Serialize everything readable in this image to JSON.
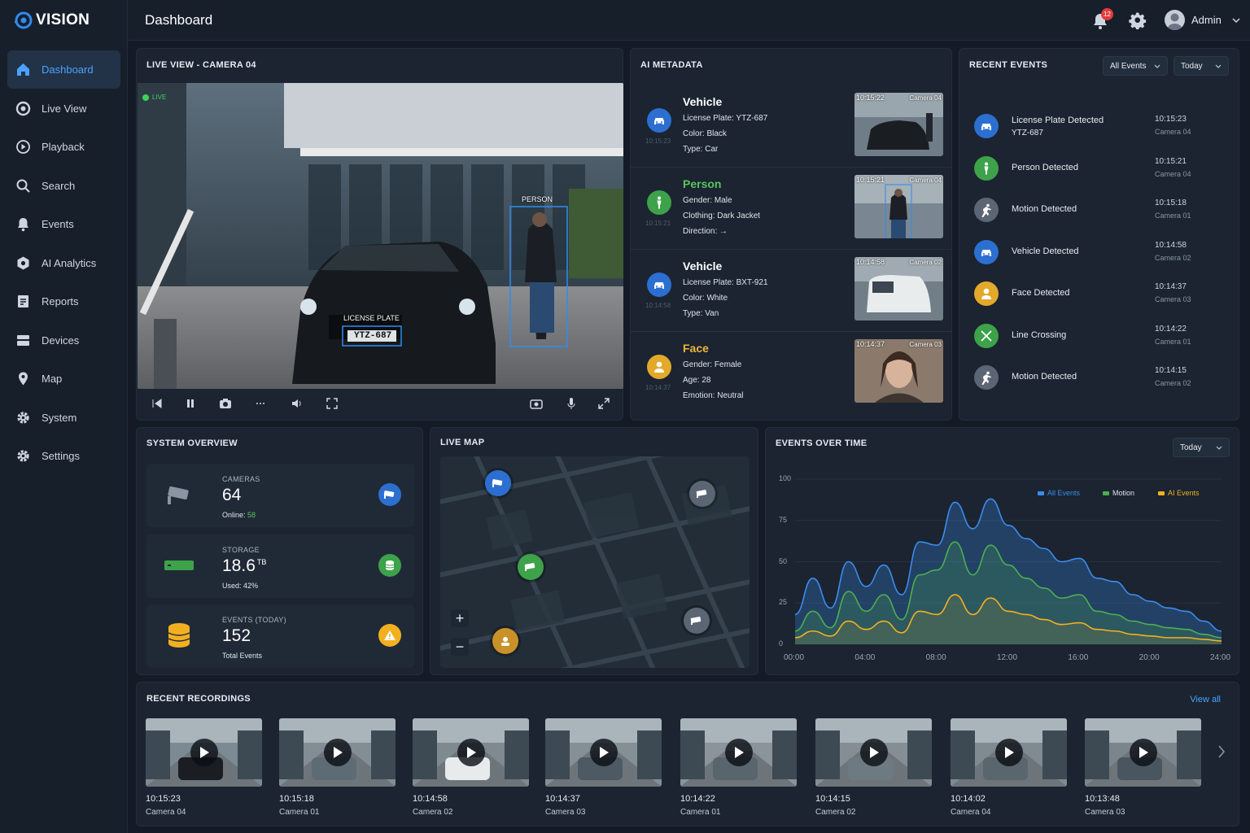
{
  "app": {
    "name": "VISION"
  },
  "colors": {
    "accent": "#4aa3ff",
    "vehicle": "#2c6fd1",
    "person": "#3da24a",
    "face": "#e2a92a",
    "motion": "#6b7585",
    "line": "#3da24a",
    "warning": "#f2b021"
  },
  "sidebar": {
    "items": [
      {
        "label": "Dashboard",
        "icon": "home-icon",
        "active": true
      },
      {
        "label": "Live View",
        "icon": "camera-lens-icon"
      },
      {
        "label": "Playback",
        "icon": "play-circle-icon"
      },
      {
        "label": "Search",
        "icon": "search-icon"
      },
      {
        "label": "Events",
        "icon": "alert-bell-icon"
      },
      {
        "label": "AI Analytics",
        "icon": "ai-chip-icon"
      },
      {
        "label": "Reports",
        "icon": "report-icon"
      },
      {
        "label": "Devices",
        "icon": "server-icon"
      },
      {
        "label": "Map",
        "icon": "map-pin-icon"
      },
      {
        "label": "System",
        "icon": "gear-icon"
      },
      {
        "label": "Settings",
        "icon": "gear-icon"
      }
    ]
  },
  "header": {
    "title": "Dashboard",
    "notification_count": "12",
    "user": "Admin"
  },
  "live": {
    "title": "LIVE VIEW - CAMERA 04",
    "live_label": "LIVE",
    "person_label": "PERSON",
    "plate_label": "LICENSE PLATE",
    "plate_value": "YTZ-687"
  },
  "metadata": {
    "title": "AI METADATA",
    "items": [
      {
        "type": "Vehicle",
        "color": "#ffffff",
        "icon": "car-icon",
        "icon_bg": "#2c6fd1",
        "time_small": "10:15:23",
        "lines": [
          "License Plate: YTZ-687",
          "Color: Black",
          "Type: Car"
        ],
        "thumb_time": "10:15:22",
        "thumb_cam": "Camera 04"
      },
      {
        "type": "Person",
        "color": "#5cc45f",
        "icon": "person-icon",
        "icon_bg": "#3da24a",
        "time_small": "10:15:21",
        "lines": [
          "Gender: Male",
          "Clothing: Dark Jacket",
          "Direction: →"
        ],
        "thumb_time": "10:15:21",
        "thumb_cam": "Camera 04"
      },
      {
        "type": "Vehicle",
        "color": "#ffffff",
        "icon": "car-icon",
        "icon_bg": "#2c6fd1",
        "time_small": "10:14:58",
        "lines": [
          "License Plate: BXT-921",
          "Color: White",
          "Type: Van"
        ],
        "thumb_time": "10:14:58",
        "thumb_cam": "Camera 02"
      },
      {
        "type": "Face",
        "color": "#f0b43a",
        "icon": "face-icon",
        "icon_bg": "#e2a92a",
        "time_small": "10:14:37",
        "lines": [
          "Gender: Female",
          "Age: 28",
          "Emotion: Neutral"
        ],
        "thumb_time": "10:14:37",
        "thumb_cam": "Camera 03"
      }
    ]
  },
  "events": {
    "title": "RECENT EVENTS",
    "filter": "All Events",
    "range": "Today",
    "items": [
      {
        "label": "License Plate Detected",
        "sub": "YTZ-687",
        "time": "10:15:23",
        "cam": "Camera 04",
        "icon": "car-icon",
        "bg": "#2c6fd1"
      },
      {
        "label": "Person Detected",
        "sub": "",
        "time": "10:15:21",
        "cam": "Camera 04",
        "icon": "person-icon",
        "bg": "#3da24a"
      },
      {
        "label": "Motion Detected",
        "sub": "",
        "time": "10:15:18",
        "cam": "Camera 01",
        "icon": "motion-icon",
        "bg": "#5b6574"
      },
      {
        "label": "Vehicle Detected",
        "sub": "",
        "time": "10:14:58",
        "cam": "Camera 02",
        "icon": "car-icon",
        "bg": "#2c6fd1"
      },
      {
        "label": "Face Detected",
        "sub": "",
        "time": "10:14:37",
        "cam": "Camera 03",
        "icon": "face-icon",
        "bg": "#e2a92a"
      },
      {
        "label": "Line Crossing",
        "sub": "",
        "time": "10:14:22",
        "cam": "Camera 01",
        "icon": "line-crossing-icon",
        "bg": "#3da24a"
      },
      {
        "label": "Motion Detected",
        "sub": "",
        "time": "10:14:15",
        "cam": "Camera 02",
        "icon": "motion-icon",
        "bg": "#5b6574"
      }
    ]
  },
  "overview": {
    "title": "SYSTEM OVERVIEW",
    "cameras": {
      "label": "CAMERAS",
      "value": "64",
      "sub_label": "Online: ",
      "sub_value": "58"
    },
    "storage": {
      "label": "STORAGE",
      "value": "18.6",
      "unit": "TB",
      "sub": "Used: 42%"
    },
    "events": {
      "label": "EVENTS (TODAY)",
      "value": "152",
      "sub": "Total Events"
    }
  },
  "map": {
    "title": "LIVE MAP",
    "zoom_in": "+",
    "zoom_out": "−"
  },
  "chart_data": {
    "type": "area",
    "title": "EVENTS OVER TIME",
    "range": "Today",
    "legend": [
      "All Events",
      "Motion",
      "AI Events"
    ],
    "legend_position": "top-right",
    "x": [
      "00:00",
      "01:00",
      "02:00",
      "03:00",
      "04:00",
      "05:00",
      "06:00",
      "07:00",
      "08:00",
      "09:00",
      "10:00",
      "11:00",
      "12:00",
      "13:00",
      "14:00",
      "15:00",
      "16:00",
      "17:00",
      "18:00",
      "19:00",
      "20:00",
      "21:00",
      "22:00",
      "23:00",
      "24:00"
    ],
    "xticks": [
      "00:00",
      "04:00",
      "08:00",
      "12:00",
      "16:00",
      "20:00",
      "24:00"
    ],
    "yticks": [
      0,
      25,
      50,
      75,
      100
    ],
    "ylim": [
      0,
      100
    ],
    "series": [
      {
        "name": "All Events",
        "color": "#3b8cf0",
        "values": [
          18,
          40,
          22,
          50,
          35,
          48,
          30,
          62,
          60,
          86,
          70,
          88,
          72,
          64,
          58,
          50,
          52,
          40,
          38,
          30,
          26,
          22,
          20,
          14,
          8
        ]
      },
      {
        "name": "Motion",
        "color": "#4caf50",
        "values": [
          8,
          20,
          10,
          32,
          20,
          30,
          15,
          42,
          45,
          62,
          42,
          60,
          48,
          40,
          34,
          28,
          30,
          20,
          18,
          14,
          12,
          10,
          9,
          6,
          4
        ]
      },
      {
        "name": "AI Events",
        "color": "#f2b021",
        "values": [
          4,
          8,
          5,
          14,
          9,
          14,
          7,
          20,
          18,
          30,
          18,
          28,
          20,
          18,
          15,
          12,
          13,
          9,
          8,
          6,
          5,
          4,
          4,
          3,
          2
        ]
      }
    ]
  },
  "recordings": {
    "title": "RECENT RECORDINGS",
    "view_all": "View all",
    "items": [
      {
        "time": "10:15:23",
        "cam": "Camera 04"
      },
      {
        "time": "10:15:18",
        "cam": "Camera 01"
      },
      {
        "time": "10:14:58",
        "cam": "Camera 02"
      },
      {
        "time": "10:14:37",
        "cam": "Camera 03"
      },
      {
        "time": "10:14:22",
        "cam": "Camera 01"
      },
      {
        "time": "10:14:15",
        "cam": "Camera 02"
      },
      {
        "time": "10:14:02",
        "cam": "Camera 04"
      },
      {
        "time": "10:13:48",
        "cam": "Camera 03"
      }
    ]
  }
}
